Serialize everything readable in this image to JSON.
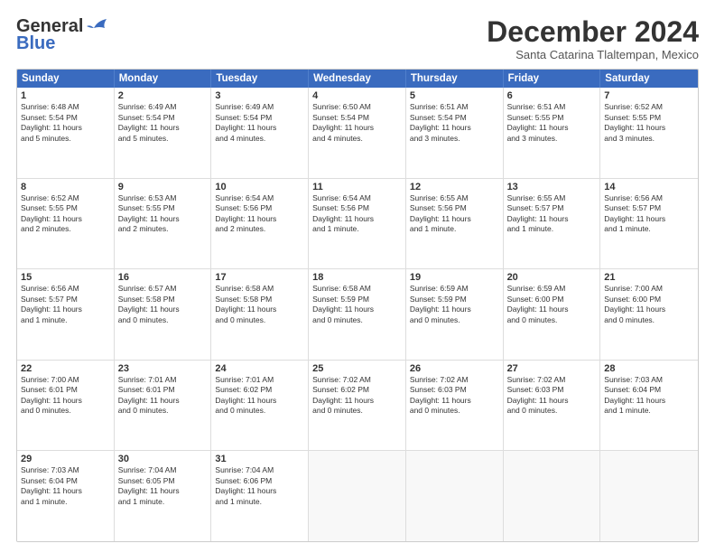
{
  "header": {
    "logo_line1": "General",
    "logo_line2": "Blue",
    "month": "December 2024",
    "location": "Santa Catarina Tlaltempan, Mexico"
  },
  "weekdays": [
    "Sunday",
    "Monday",
    "Tuesday",
    "Wednesday",
    "Thursday",
    "Friday",
    "Saturday"
  ],
  "rows": [
    [
      {
        "day": "1",
        "info": "Sunrise: 6:48 AM\nSunset: 5:54 PM\nDaylight: 11 hours\nand 5 minutes."
      },
      {
        "day": "2",
        "info": "Sunrise: 6:49 AM\nSunset: 5:54 PM\nDaylight: 11 hours\nand 5 minutes."
      },
      {
        "day": "3",
        "info": "Sunrise: 6:49 AM\nSunset: 5:54 PM\nDaylight: 11 hours\nand 4 minutes."
      },
      {
        "day": "4",
        "info": "Sunrise: 6:50 AM\nSunset: 5:54 PM\nDaylight: 11 hours\nand 4 minutes."
      },
      {
        "day": "5",
        "info": "Sunrise: 6:51 AM\nSunset: 5:54 PM\nDaylight: 11 hours\nand 3 minutes."
      },
      {
        "day": "6",
        "info": "Sunrise: 6:51 AM\nSunset: 5:55 PM\nDaylight: 11 hours\nand 3 minutes."
      },
      {
        "day": "7",
        "info": "Sunrise: 6:52 AM\nSunset: 5:55 PM\nDaylight: 11 hours\nand 3 minutes."
      }
    ],
    [
      {
        "day": "8",
        "info": "Sunrise: 6:52 AM\nSunset: 5:55 PM\nDaylight: 11 hours\nand 2 minutes."
      },
      {
        "day": "9",
        "info": "Sunrise: 6:53 AM\nSunset: 5:55 PM\nDaylight: 11 hours\nand 2 minutes."
      },
      {
        "day": "10",
        "info": "Sunrise: 6:54 AM\nSunset: 5:56 PM\nDaylight: 11 hours\nand 2 minutes."
      },
      {
        "day": "11",
        "info": "Sunrise: 6:54 AM\nSunset: 5:56 PM\nDaylight: 11 hours\nand 1 minute."
      },
      {
        "day": "12",
        "info": "Sunrise: 6:55 AM\nSunset: 5:56 PM\nDaylight: 11 hours\nand 1 minute."
      },
      {
        "day": "13",
        "info": "Sunrise: 6:55 AM\nSunset: 5:57 PM\nDaylight: 11 hours\nand 1 minute."
      },
      {
        "day": "14",
        "info": "Sunrise: 6:56 AM\nSunset: 5:57 PM\nDaylight: 11 hours\nand 1 minute."
      }
    ],
    [
      {
        "day": "15",
        "info": "Sunrise: 6:56 AM\nSunset: 5:57 PM\nDaylight: 11 hours\nand 1 minute."
      },
      {
        "day": "16",
        "info": "Sunrise: 6:57 AM\nSunset: 5:58 PM\nDaylight: 11 hours\nand 0 minutes."
      },
      {
        "day": "17",
        "info": "Sunrise: 6:58 AM\nSunset: 5:58 PM\nDaylight: 11 hours\nand 0 minutes."
      },
      {
        "day": "18",
        "info": "Sunrise: 6:58 AM\nSunset: 5:59 PM\nDaylight: 11 hours\nand 0 minutes."
      },
      {
        "day": "19",
        "info": "Sunrise: 6:59 AM\nSunset: 5:59 PM\nDaylight: 11 hours\nand 0 minutes."
      },
      {
        "day": "20",
        "info": "Sunrise: 6:59 AM\nSunset: 6:00 PM\nDaylight: 11 hours\nand 0 minutes."
      },
      {
        "day": "21",
        "info": "Sunrise: 7:00 AM\nSunset: 6:00 PM\nDaylight: 11 hours\nand 0 minutes."
      }
    ],
    [
      {
        "day": "22",
        "info": "Sunrise: 7:00 AM\nSunset: 6:01 PM\nDaylight: 11 hours\nand 0 minutes."
      },
      {
        "day": "23",
        "info": "Sunrise: 7:01 AM\nSunset: 6:01 PM\nDaylight: 11 hours\nand 0 minutes."
      },
      {
        "day": "24",
        "info": "Sunrise: 7:01 AM\nSunset: 6:02 PM\nDaylight: 11 hours\nand 0 minutes."
      },
      {
        "day": "25",
        "info": "Sunrise: 7:02 AM\nSunset: 6:02 PM\nDaylight: 11 hours\nand 0 minutes."
      },
      {
        "day": "26",
        "info": "Sunrise: 7:02 AM\nSunset: 6:03 PM\nDaylight: 11 hours\nand 0 minutes."
      },
      {
        "day": "27",
        "info": "Sunrise: 7:02 AM\nSunset: 6:03 PM\nDaylight: 11 hours\nand 0 minutes."
      },
      {
        "day": "28",
        "info": "Sunrise: 7:03 AM\nSunset: 6:04 PM\nDaylight: 11 hours\nand 1 minute."
      }
    ],
    [
      {
        "day": "29",
        "info": "Sunrise: 7:03 AM\nSunset: 6:04 PM\nDaylight: 11 hours\nand 1 minute."
      },
      {
        "day": "30",
        "info": "Sunrise: 7:04 AM\nSunset: 6:05 PM\nDaylight: 11 hours\nand 1 minute."
      },
      {
        "day": "31",
        "info": "Sunrise: 7:04 AM\nSunset: 6:06 PM\nDaylight: 11 hours\nand 1 minute."
      },
      {
        "day": "",
        "info": ""
      },
      {
        "day": "",
        "info": ""
      },
      {
        "day": "",
        "info": ""
      },
      {
        "day": "",
        "info": ""
      }
    ]
  ]
}
